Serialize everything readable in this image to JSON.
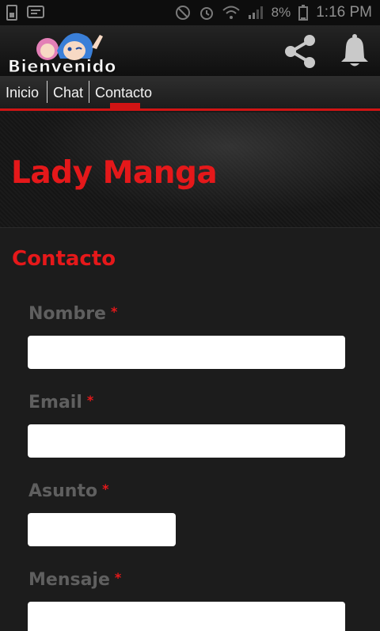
{
  "status_bar": {
    "battery": "8%",
    "time": "1:16 PM",
    "icons": [
      "sim-icon",
      "notification-icon",
      "vibrate-icon",
      "alarm-icon",
      "wifi-icon",
      "signal-icon",
      "battery-icon"
    ]
  },
  "app_bar": {
    "logo_text": "Bienvenido",
    "actions": [
      "share-icon",
      "bell-icon"
    ]
  },
  "nav": {
    "items": [
      {
        "label": "Inicio"
      },
      {
        "label": "Chat"
      },
      {
        "label": "Contacto"
      }
    ],
    "active": "Contacto",
    "accent": "#d11414"
  },
  "hero": {
    "title": "Lady Manga"
  },
  "form": {
    "title": "Contacto",
    "required_mark": "*",
    "fields": [
      {
        "label": "Nombre",
        "value": ""
      },
      {
        "label": "Email",
        "value": ""
      },
      {
        "label": "Asunto",
        "value": ""
      },
      {
        "label": "Mensaje",
        "value": ""
      }
    ]
  },
  "colors": {
    "accent_red": "#e5181a",
    "background": "#1c1c1c",
    "label_gray": "#5f5f5f"
  }
}
